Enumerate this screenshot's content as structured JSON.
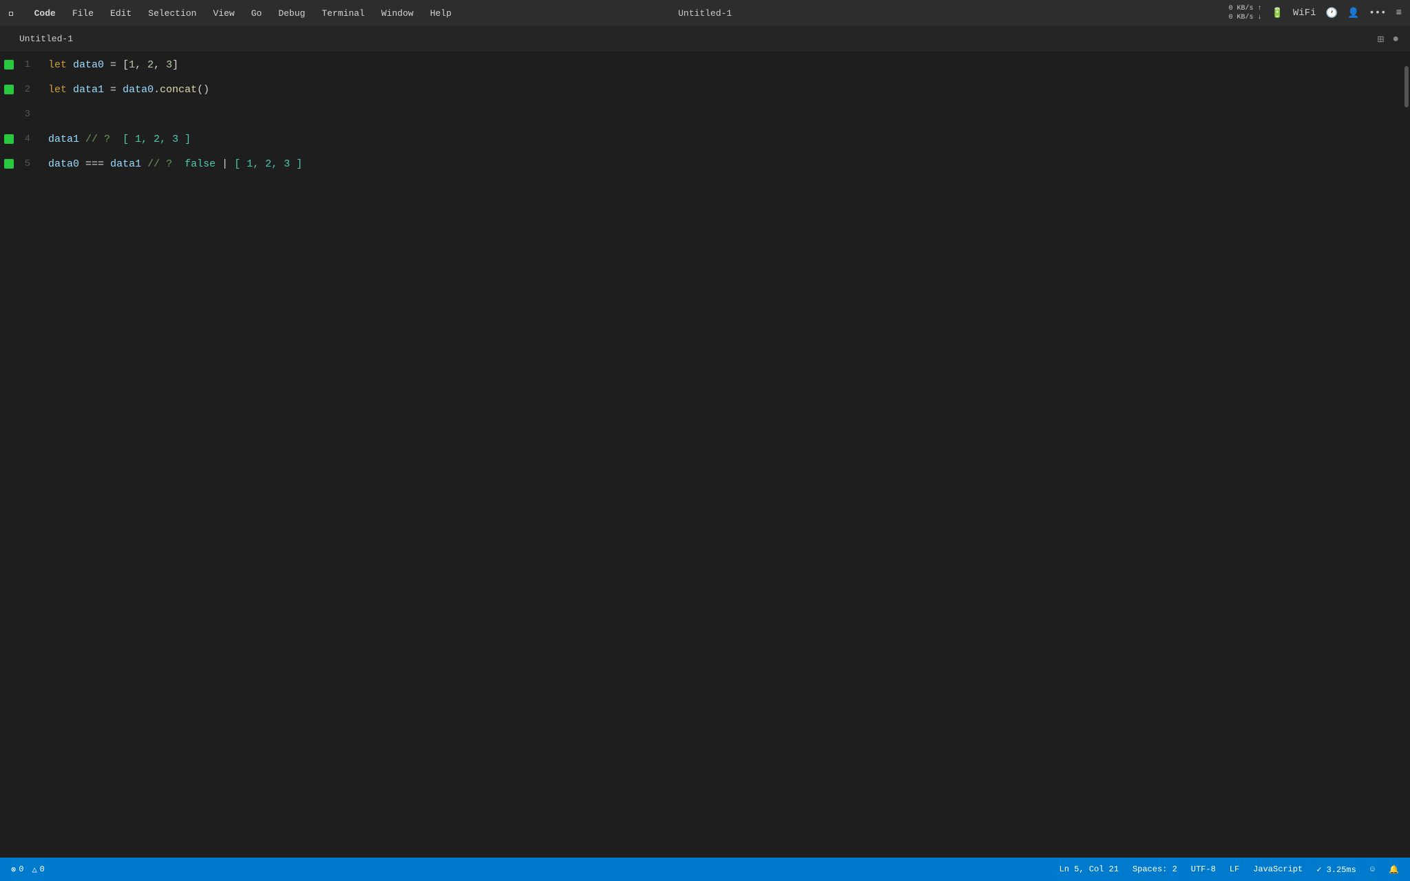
{
  "menubar": {
    "apple": "⌘",
    "items": [
      {
        "label": "Code",
        "bold": true
      },
      {
        "label": "File"
      },
      {
        "label": "Edit"
      },
      {
        "label": "Selection"
      },
      {
        "label": "View"
      },
      {
        "label": "Go"
      },
      {
        "label": "Debug"
      },
      {
        "label": "Terminal"
      },
      {
        "label": "Window"
      },
      {
        "label": "Help"
      }
    ],
    "title": "Untitled-1",
    "network": "0 KB/s\n0 KB/s"
  },
  "titlebar": {
    "tab_label": "Untitled-1"
  },
  "editor": {
    "lines": [
      {
        "number": "1",
        "has_indicator": true,
        "content": "let data0 = [1, 2, 3]"
      },
      {
        "number": "2",
        "has_indicator": true,
        "content": "let data1 = data0.concat()"
      },
      {
        "number": "3",
        "has_indicator": false,
        "content": ""
      },
      {
        "number": "4",
        "has_indicator": true,
        "content": "data1 // ?  [ 1, 2, 3 ]"
      },
      {
        "number": "5",
        "has_indicator": true,
        "content": "data0 === data1 // ?  false | [ 1, 2, 3 ]"
      }
    ]
  },
  "statusbar": {
    "errors": "0",
    "warnings": "0",
    "position": "Ln 5, Col 21",
    "spaces": "Spaces: 2",
    "encoding": "UTF-8",
    "eol": "LF",
    "language": "JavaScript",
    "timing": "✓ 3.25ms",
    "error_icon": "⊗",
    "warning_icon": "△",
    "smiley_icon": "☺",
    "bell_icon": "🔔"
  }
}
